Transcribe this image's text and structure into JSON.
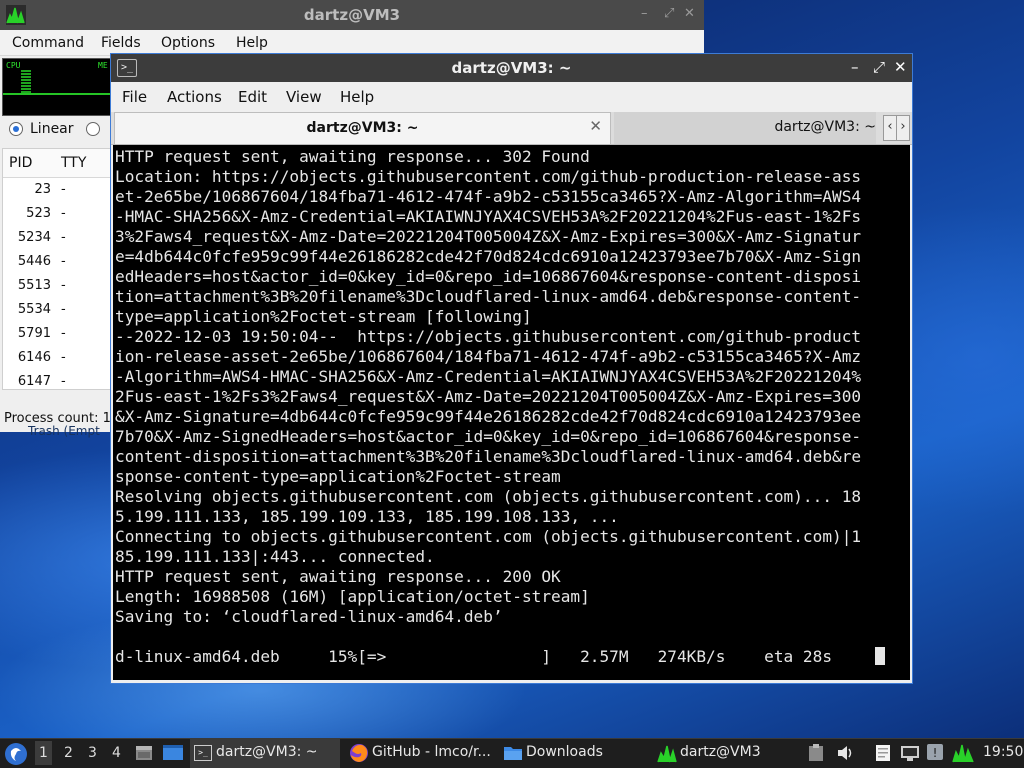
{
  "task_manager": {
    "title": "dartz@VM3",
    "menu": [
      "Command",
      "Fields",
      "Options",
      "Help"
    ],
    "graph": {
      "cpu_label": "CPU",
      "mem_label": "ME"
    },
    "radio": {
      "linear_label": "Linear",
      "selected": "Linear"
    },
    "columns": {
      "pid": "PID",
      "tty": "TTY"
    },
    "rows": [
      {
        "pid": "23",
        "tty": "-"
      },
      {
        "pid": "523",
        "tty": "-"
      },
      {
        "pid": "5234",
        "tty": "-"
      },
      {
        "pid": "5446",
        "tty": "-"
      },
      {
        "pid": "5513",
        "tty": "-"
      },
      {
        "pid": "5534",
        "tty": "-"
      },
      {
        "pid": "5791",
        "tty": "-"
      },
      {
        "pid": "6146",
        "tty": "-"
      },
      {
        "pid": "6147",
        "tty": "-"
      }
    ],
    "status": "Process count: 1",
    "behind_text": "Trash (Empt"
  },
  "terminal": {
    "title": "dartz@VM3: ~",
    "menu": [
      "File",
      "Actions",
      "Edit",
      "View",
      "Help"
    ],
    "tabs": [
      {
        "label": "dartz@VM3: ~",
        "active": true
      },
      {
        "label": "dartz@VM3: ~",
        "active": false
      }
    ],
    "lines": [
      "HTTP request sent, awaiting response... 302 Found",
      "Location: https://objects.githubusercontent.com/github-production-release-ass",
      "et-2e65be/106867604/184fba71-4612-474f-a9b2-c53155ca3465?X-Amz-Algorithm=AWS4",
      "-HMAC-SHA256&X-Amz-Credential=AKIAIWNJYAX4CSVEH53A%2F20221204%2Fus-east-1%2Fs",
      "3%2Faws4_request&X-Amz-Date=20221204T005004Z&X-Amz-Expires=300&X-Amz-Signatur",
      "e=4db644c0fcfe959c99f44e26186282cde42f70d824cdc6910a12423793ee7b70&X-Amz-Sign",
      "edHeaders=host&actor_id=0&key_id=0&repo_id=106867604&response-content-disposi",
      "tion=attachment%3B%20filename%3Dcloudflared-linux-amd64.deb&response-content-",
      "type=application%2Foctet-stream [following]",
      "--2022-12-03 19:50:04--  https://objects.githubusercontent.com/github-product",
      "ion-release-asset-2e65be/106867604/184fba71-4612-474f-a9b2-c53155ca3465?X-Amz",
      "-Algorithm=AWS4-HMAC-SHA256&X-Amz-Credential=AKIAIWNJYAX4CSVEH53A%2F20221204%",
      "2Fus-east-1%2Fs3%2Faws4_request&X-Amz-Date=20221204T005004Z&X-Amz-Expires=300",
      "&X-Amz-Signature=4db644c0fcfe959c99f44e26186282cde42f70d824cdc6910a12423793ee",
      "7b70&X-Amz-SignedHeaders=host&actor_id=0&key_id=0&repo_id=106867604&response-",
      "content-disposition=attachment%3B%20filename%3Dcloudflared-linux-amd64.deb&re",
      "sponse-content-type=application%2Foctet-stream",
      "Resolving objects.githubusercontent.com (objects.githubusercontent.com)... 18",
      "5.199.111.133, 185.199.109.133, 185.199.108.133, ...",
      "Connecting to objects.githubusercontent.com (objects.githubusercontent.com)|1",
      "85.199.111.133|:443... connected.",
      "HTTP request sent, awaiting response... 200 OK",
      "Length: 16988508 (16M) [application/octet-stream]",
      "Saving to: ‘cloudflared-linux-amd64.deb’",
      "",
      "d-linux-amd64.deb     15%[=>                ]   2.57M   274KB/s    eta 28s    "
    ]
  },
  "taskbar": {
    "workspaces": [
      "1",
      "2",
      "3",
      "4"
    ],
    "current_workspace": "1",
    "tasks": [
      {
        "label": "dartz@VM3: ~",
        "icon": "terminal-icon",
        "active": true
      },
      {
        "label": "GitHub - lmco/r...",
        "icon": "firefox-icon",
        "active": false
      },
      {
        "label": "Downloads",
        "icon": "folder-icon",
        "active": false
      },
      {
        "label": "dartz@VM3",
        "icon": "task-manager-icon",
        "active": false
      }
    ],
    "clock": "19:50"
  },
  "colors": {
    "accent": "#3d7bd6",
    "terminal_bg": "#000000",
    "terminal_fg": "#e6e6e6",
    "graph_green": "#25c425"
  }
}
